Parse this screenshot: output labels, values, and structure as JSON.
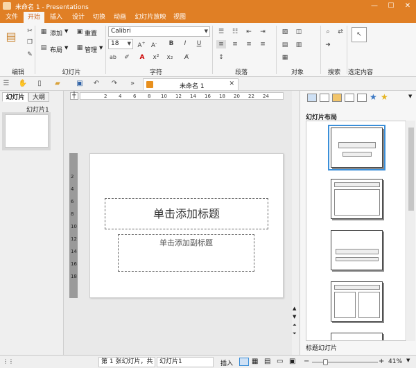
{
  "window": {
    "title": "未命名 1 - Presentations",
    "minimize": "—",
    "maximize": "☐",
    "close": "✕"
  },
  "menu": [
    {
      "label": "文件",
      "active": false
    },
    {
      "label": "开始",
      "active": true
    },
    {
      "label": "插入",
      "active": false
    },
    {
      "label": "设计",
      "active": false
    },
    {
      "label": "切换",
      "active": false
    },
    {
      "label": "动画",
      "active": false
    },
    {
      "label": "幻灯片放映",
      "active": false
    },
    {
      "label": "视图",
      "active": false
    }
  ],
  "ribbon": {
    "groups": {
      "edit": "编辑",
      "slides": "幻灯片",
      "chars": "字符",
      "paragraph": "段落",
      "objects": "对象",
      "search": "搜索",
      "select": "选定内容"
    },
    "slides": {
      "add": "添加",
      "reset": "重置",
      "layout": "布局",
      "manage": "管理"
    },
    "font": {
      "name": "Calibri",
      "size": "18"
    }
  },
  "toolbar": {
    "doc_tab": "未命名 1",
    "doc_close": "✕"
  },
  "left_panel": {
    "tab_slides": "幻灯片",
    "tab_outline": "大纲",
    "thumb_label": "幻灯片1"
  },
  "ruler": {
    "h_ticks": [
      "2",
      "4",
      "6",
      "8",
      "10",
      "12",
      "14",
      "16",
      "18",
      "20",
      "22",
      "24"
    ],
    "v_ticks": [
      "2",
      "4",
      "6",
      "8",
      "10",
      "12",
      "14",
      "16",
      "18"
    ]
  },
  "slide": {
    "title_placeholder": "单击添加标题",
    "subtitle_placeholder": "单击添加副标题"
  },
  "right_panel": {
    "title": "幻灯片布局",
    "footer": "标题幻灯片"
  },
  "status": {
    "slide_info": "第 1 张幻灯片，共 1",
    "slide_name": "幻灯片1",
    "mode": "插入",
    "zoom": "41%"
  }
}
